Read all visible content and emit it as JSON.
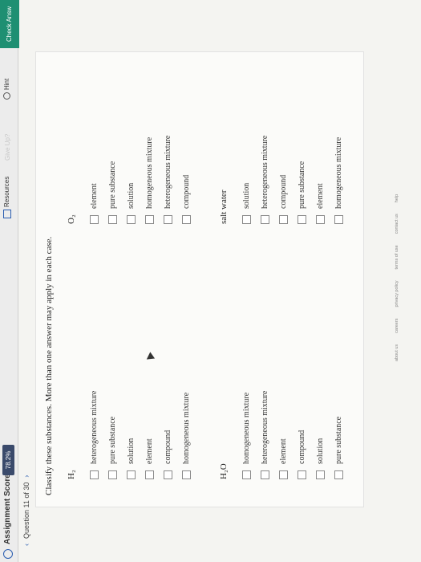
{
  "header": {
    "score_label": "Assignment Score:",
    "score_value": "78.2%",
    "resources_label": "Resources",
    "giveup_label": "Give Up?",
    "hint_label": "Hint",
    "check_label": "Check Answ"
  },
  "question_nav": {
    "label": "Question 11 of 30"
  },
  "prompt": "Classify these substances. More than one answer may apply in each case.",
  "groups": [
    {
      "title": "H₂",
      "options": [
        "heterogeneous mixture",
        "pure substance",
        "solution",
        "element",
        "compound",
        "homogeneous mixture"
      ]
    },
    {
      "title": "O₂",
      "options": [
        "element",
        "pure substance",
        "solution",
        "homogeneous mixture",
        "heterogeneous mixture",
        "compound"
      ]
    },
    {
      "title": "H₂O",
      "options": [
        "homogeneous mixture",
        "heterogeneous mixture",
        "element",
        "compound",
        "solution",
        "pure substance"
      ]
    },
    {
      "title": "salt water",
      "options": [
        "solution",
        "heterogeneous mixture",
        "compound",
        "pure substance",
        "element",
        "homogeneous mixture"
      ]
    }
  ],
  "footer": [
    "about us",
    "careers",
    "privacy policy",
    "terms of use",
    "contact us",
    "help"
  ]
}
